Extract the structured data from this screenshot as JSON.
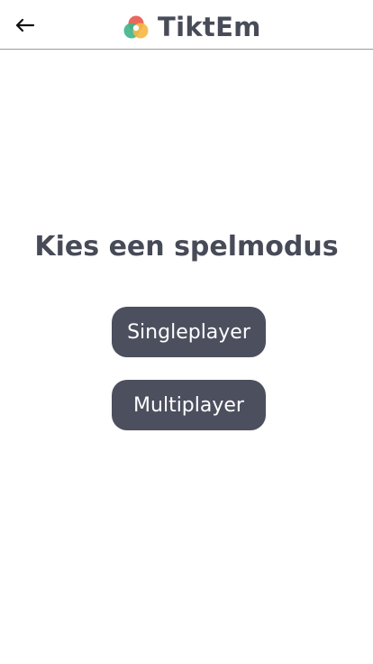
{
  "header": {
    "back_icon": "arrow-left-icon",
    "brand_name": "TiktEm",
    "logo_icon": "tiktem-logo-icon",
    "logo_colors": [
      "#e85a4f",
      "#3eb489",
      "#f5b841"
    ]
  },
  "main": {
    "title": "Kies een spelmodus",
    "buttons": {
      "singleplayer": "Singleplayer",
      "multiplayer": "Multiplayer"
    }
  },
  "colors": {
    "button_bg": "#4c4f5e",
    "text_dark": "#474a57",
    "header_border": "#9a9a9a"
  }
}
